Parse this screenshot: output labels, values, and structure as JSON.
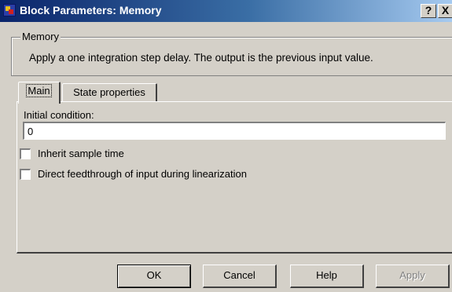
{
  "window": {
    "title": "Block Parameters: Memory",
    "help_label": "?",
    "close_label": "X"
  },
  "group": {
    "label": "Memory",
    "description": "Apply a one integration step delay. The output is the previous input value."
  },
  "tabs": [
    {
      "label": "Main",
      "selected": true
    },
    {
      "label": "State properties",
      "selected": false
    }
  ],
  "main": {
    "initial_condition_label": "Initial condition:",
    "initial_condition_value": "0",
    "checkboxes": [
      {
        "label": "Inherit sample time",
        "checked": false
      },
      {
        "label": "Direct feedthrough of input during linearization",
        "checked": false
      }
    ]
  },
  "buttons": {
    "ok": "OK",
    "cancel": "Cancel",
    "help": "Help",
    "apply": "Apply"
  }
}
